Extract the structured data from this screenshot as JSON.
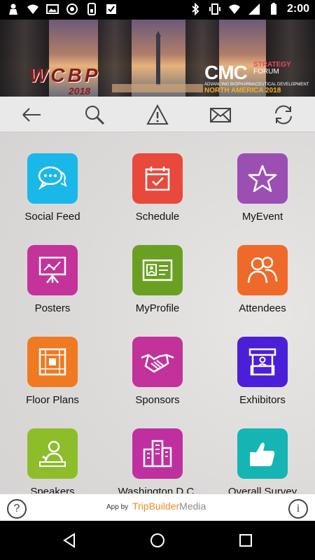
{
  "status_bar": {
    "time": "2:00",
    "icons": [
      "person-icon",
      "wifi-icon",
      "image-icon",
      "circle-icon",
      "sim-icon",
      "checkbox-icon",
      "bluetooth-icon",
      "vibrate-icon",
      "wifi-signal-icon",
      "cell-signal-icon",
      "battery-icon"
    ]
  },
  "banner": {
    "left_logo": "WCBP",
    "left_year": "2018",
    "right_logo_main": "CMC",
    "right_logo_line1": "STRATEGY",
    "right_logo_line2": "FORUM",
    "right_logo_sub": "ADVANCING BIOPHARMACEUTICAL DEVELOPMENT",
    "right_logo_region": "NORTH AMERICA 2018"
  },
  "toolbar": [
    "back-arrow-icon",
    "search-icon",
    "warning-icon",
    "mail-icon",
    "refresh-icon"
  ],
  "tiles": [
    {
      "label": "Social Feed",
      "color": "#19b8e8",
      "icon": "chat-bubbles-icon"
    },
    {
      "label": "Schedule",
      "color": "#e8493c",
      "icon": "calendar-check-icon"
    },
    {
      "label": "MyEvent",
      "color": "#9b4fb3",
      "icon": "star-icon"
    },
    {
      "label": "Posters",
      "color": "#c3339a",
      "icon": "presentation-board-icon"
    },
    {
      "label": "MyProfile",
      "color": "#6aa022",
      "icon": "id-card-icon"
    },
    {
      "label": "Attendees",
      "color": "#ef6a2a",
      "icon": "people-icon"
    },
    {
      "label": "Floor Plans",
      "color": "#ef7a22",
      "icon": "floor-plan-icon"
    },
    {
      "label": "Sponsors",
      "color": "#c2329a",
      "icon": "handshake-icon"
    },
    {
      "label": "Exhibitors",
      "color": "#4b1fd8",
      "icon": "booth-icon"
    },
    {
      "label": "Speakers",
      "color": "#8ebd2b",
      "icon": "speaker-icon"
    },
    {
      "label": "Washington D.C.",
      "color": "#c02fa0",
      "icon": "city-icon"
    },
    {
      "label": "Overall Survey",
      "color": "#17b4b4",
      "icon": "thumbs-up-icon"
    }
  ],
  "footer": {
    "help_glyph": "?",
    "app_by": "App by",
    "brand_a": "TripBuilder",
    "brand_b": "Media",
    "info_glyph": "i"
  },
  "nav": [
    "back-nav-icon",
    "home-nav-icon",
    "recents-nav-icon"
  ]
}
